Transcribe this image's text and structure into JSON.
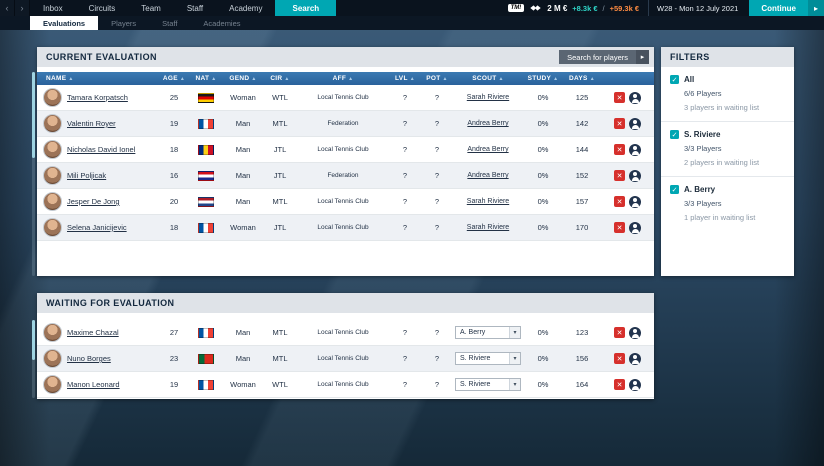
{
  "colors": {
    "accent_teal": "#00a7b3",
    "table_header_blue": "#2e6ca2",
    "danger_red": "#d6302c",
    "money_gain": "#2fd5c8",
    "money_loss": "#ff8c42"
  },
  "icons": {
    "close": "✕",
    "caret": "▾",
    "sort": "▲",
    "check": "✓",
    "chevron_right": "▸",
    "back": "‹",
    "forward": "›"
  },
  "top_bar": {
    "logo": "TM!",
    "nav": [
      {
        "label": "Inbox"
      },
      {
        "label": "Circuits"
      },
      {
        "label": "Team"
      },
      {
        "label": "Staff"
      },
      {
        "label": "Academy"
      },
      {
        "label": "Search"
      }
    ],
    "money": "2 M €",
    "gain": "+8.3k €",
    "separator": "/",
    "loss": "+59.3k €",
    "date": "W28 - Mon 12 July 2021",
    "continue_label": "Continue"
  },
  "tabs": [
    {
      "label": "Evaluations",
      "active": true
    },
    {
      "label": "Players",
      "active": false
    },
    {
      "label": "Staff",
      "active": false
    },
    {
      "label": "Academies",
      "active": false
    }
  ],
  "current_evaluation": {
    "title": "CURRENT EVALUATION",
    "search_button": "Search for players",
    "columns": [
      "NAME",
      "AGE",
      "NAT",
      "GEND",
      "CIR",
      "AFF",
      "LVL",
      "POT",
      "SCOUT",
      "STUDY",
      "DAYS"
    ],
    "rows": [
      {
        "name": "Tamara Korpatsch",
        "age": "25",
        "nat": "de",
        "gend": "Woman",
        "cir": "WTL",
        "aff": "Local Tennis Club",
        "lvl": "?",
        "pot": "?",
        "scout": "Sarah Riviere",
        "study": "0%",
        "days": "125"
      },
      {
        "name": "Valentin Royer",
        "age": "19",
        "nat": "fr",
        "gend": "Man",
        "cir": "MTL",
        "aff": "Federation",
        "lvl": "?",
        "pot": "?",
        "scout": "Andrea Berry",
        "study": "0%",
        "days": "142"
      },
      {
        "name": "Nicholas David Ionel",
        "age": "18",
        "nat": "ro",
        "gend": "Man",
        "cir": "JTL",
        "aff": "Local Tennis Club",
        "lvl": "?",
        "pot": "?",
        "scout": "Andrea Berry",
        "study": "0%",
        "days": "144"
      },
      {
        "name": "Mili Poljicak",
        "age": "16",
        "nat": "hr",
        "gend": "Man",
        "cir": "JTL",
        "aff": "Federation",
        "lvl": "?",
        "pot": "?",
        "scout": "Andrea Berry",
        "study": "0%",
        "days": "152"
      },
      {
        "name": "Jesper De Jong",
        "age": "20",
        "nat": "nl",
        "gend": "Man",
        "cir": "MTL",
        "aff": "Local Tennis Club",
        "lvl": "?",
        "pot": "?",
        "scout": "Sarah Riviere",
        "study": "0%",
        "days": "157"
      },
      {
        "name": "Selena Janicijevic",
        "age": "18",
        "nat": "fr",
        "gend": "Woman",
        "cir": "JTL",
        "aff": "Local Tennis Club",
        "lvl": "?",
        "pot": "?",
        "scout": "Sarah Riviere",
        "study": "0%",
        "days": "170"
      }
    ]
  },
  "waiting_evaluation": {
    "title": "WAITING FOR EVALUATION",
    "rows": [
      {
        "name": "Maxime Chazal",
        "age": "27",
        "nat": "fr",
        "gend": "Man",
        "cir": "MTL",
        "aff": "Local Tennis Club",
        "lvl": "?",
        "pot": "?",
        "scout": "A. Berry",
        "study": "0%",
        "days": "123"
      },
      {
        "name": "Nuno Borges",
        "age": "23",
        "nat": "pt",
        "gend": "Man",
        "cir": "MTL",
        "aff": "Local Tennis Club",
        "lvl": "?",
        "pot": "?",
        "scout": "S. Riviere",
        "study": "0%",
        "days": "156"
      },
      {
        "name": "Manon Leonard",
        "age": "19",
        "nat": "fr",
        "gend": "Woman",
        "cir": "WTL",
        "aff": "Local Tennis Club",
        "lvl": "?",
        "pot": "?",
        "scout": "S. Riviere",
        "study": "0%",
        "days": "164"
      }
    ]
  },
  "filters": {
    "title": "FILTERS",
    "items": [
      {
        "label": "All",
        "players": "6/6 Players",
        "waiting": "3 players in waiting list",
        "checked": true
      },
      {
        "label": "S. Riviere",
        "players": "3/3 Players",
        "waiting": "2 players in waiting list",
        "checked": true
      },
      {
        "label": "A. Berry",
        "players": "3/3 Players",
        "waiting": "1 player in waiting list",
        "checked": true
      }
    ]
  }
}
